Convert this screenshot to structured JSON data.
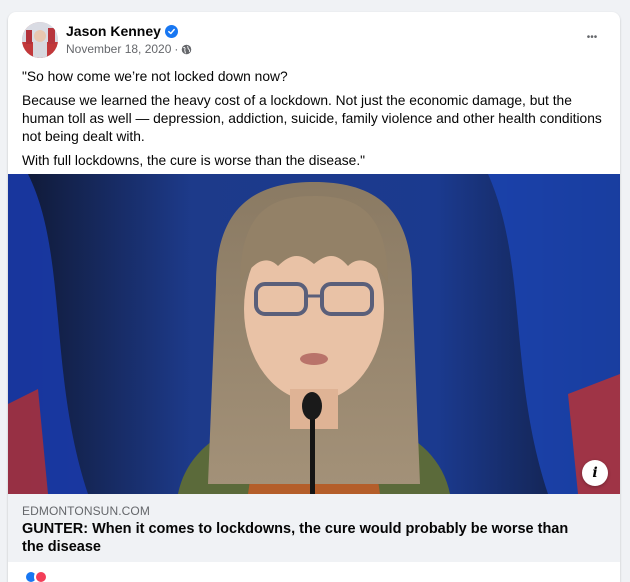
{
  "post": {
    "author": "Jason Kenney",
    "date": "November 18, 2020",
    "separator": "·",
    "more_label": "•••",
    "paragraphs": [
      "\"So how come we’re not locked down now?",
      "Because we learned the heavy cost of a lockdown. Not just the economic damage, but the human toll as well — depression, addiction, suicide, family violence and other health conditions not being dealt with.",
      "With full lockdowns, the cure is worse than the disease.\""
    ]
  },
  "link_preview": {
    "domain": "EDMONTONSUN.COM",
    "title": "GUNTER: When it comes to lockdowns, the cure would probably be worse than the disease",
    "info_label": "i"
  },
  "icons": {
    "verified": "verified-badge-icon",
    "privacy": "globe-icon",
    "menu": "more-options-icon"
  },
  "colors": {
    "verified": "#1877f2",
    "secondary_text": "#65676b",
    "background": "#f0f2f5"
  }
}
